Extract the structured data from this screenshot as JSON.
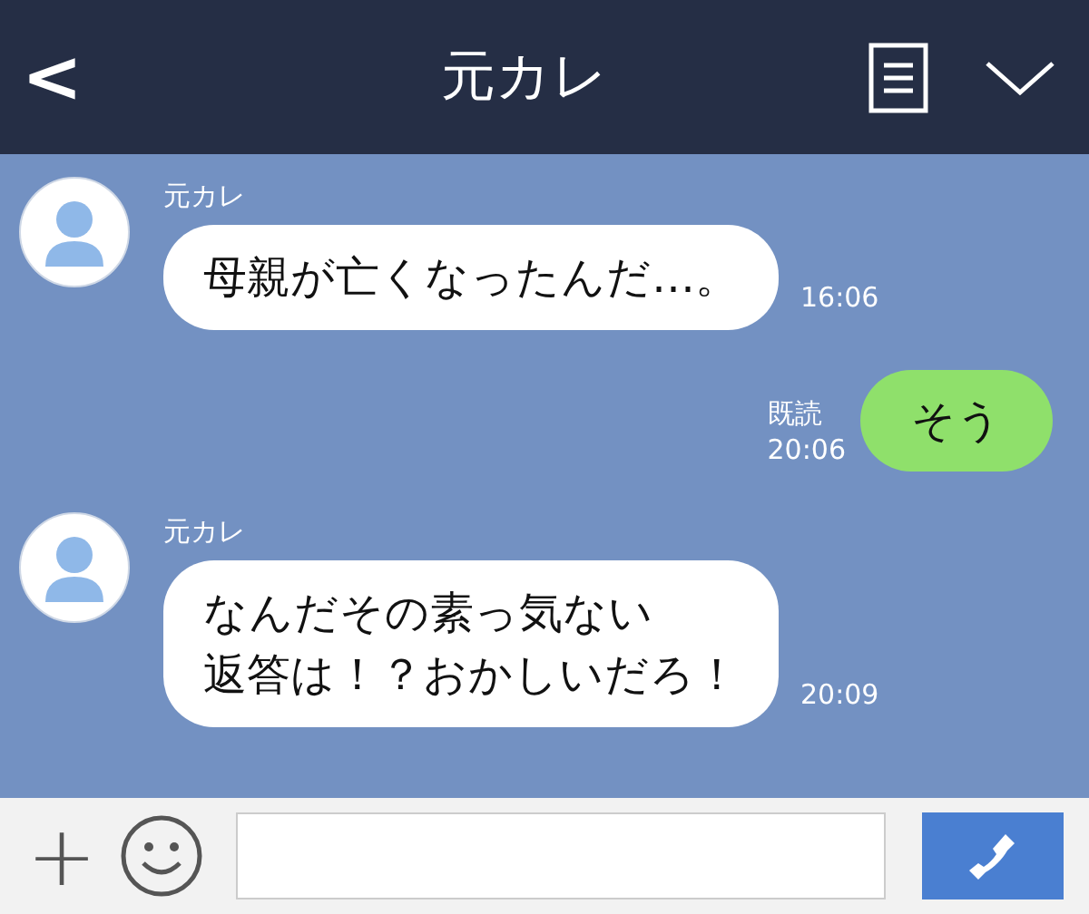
{
  "header": {
    "back": "<",
    "title": "元カレ"
  },
  "messages": [
    {
      "kind": "incoming",
      "sender": "元カレ",
      "lines": [
        "母親が亡くなったんだ…。"
      ],
      "time": "16:06"
    },
    {
      "kind": "outgoing",
      "text": "そう",
      "read": "既読",
      "time": "20:06"
    },
    {
      "kind": "incoming",
      "sender": "元カレ",
      "lines": [
        "なんだその素っ気ない",
        "返答は！？おかしいだろ！"
      ],
      "time": "20:09"
    }
  ],
  "composer": {
    "plus": "+"
  }
}
